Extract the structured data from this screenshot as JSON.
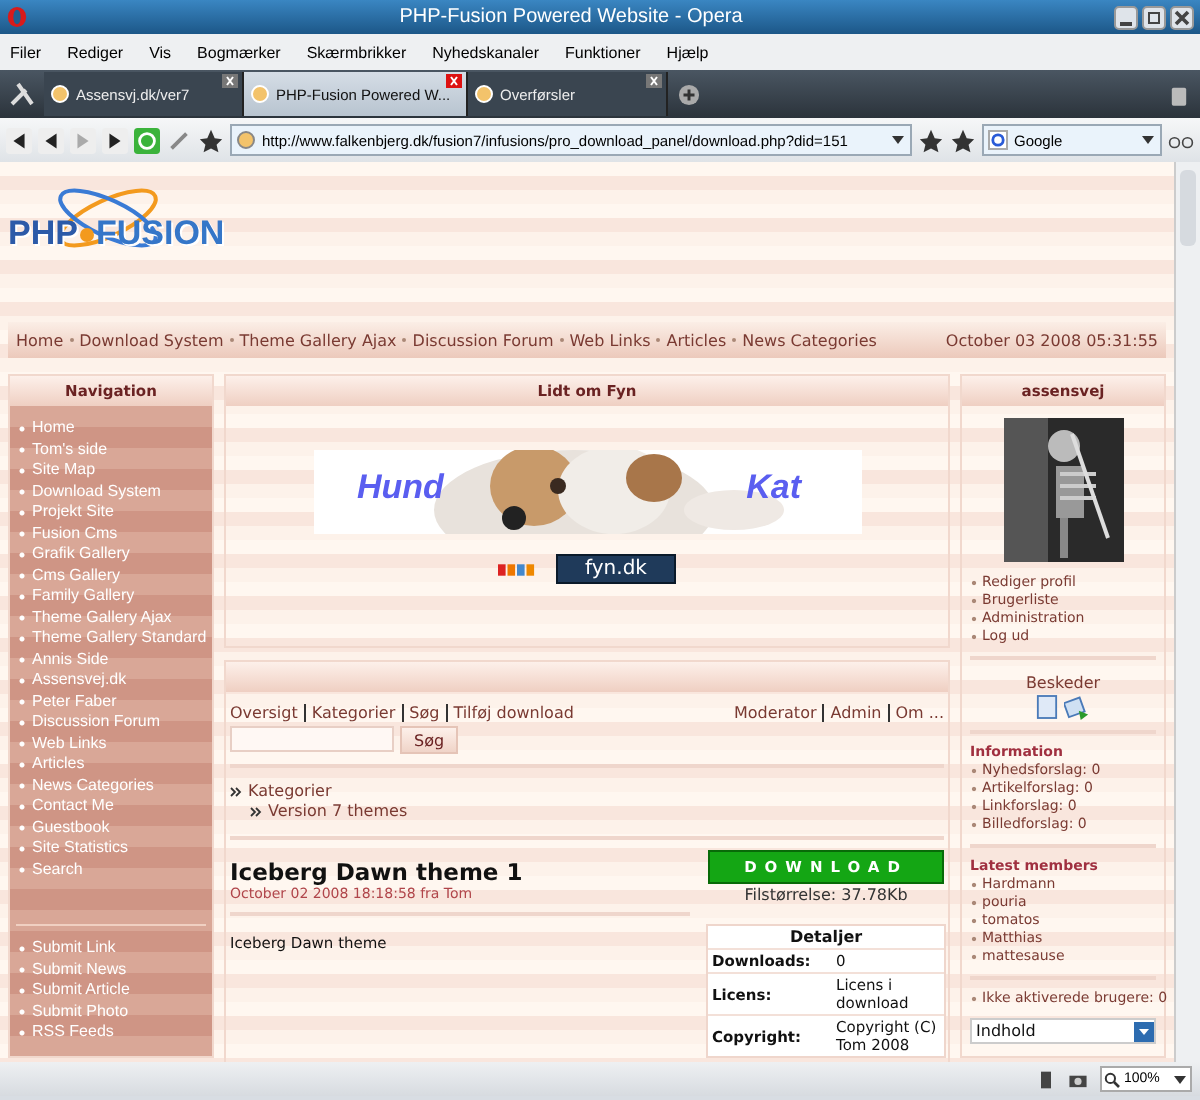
{
  "window": {
    "title": "PHP-Fusion Powered Website - Opera"
  },
  "menu": [
    "Filer",
    "Rediger",
    "Vis",
    "Bogmærker",
    "Skærmbrikker",
    "Nyhedskanaler",
    "Funktioner",
    "Hjælp"
  ],
  "tabs": [
    {
      "label": "Assensvj.dk/ver7",
      "selected": false
    },
    {
      "label": "PHP-Fusion Powered W...",
      "selected": true
    },
    {
      "label": "Overførsler",
      "selected": false
    }
  ],
  "address": {
    "url": "http://www.falkenbjerg.dk/fusion7/infusions/pro_download_panel/download.php?did=151",
    "search": "Google"
  },
  "logo": {
    "left": "PHP",
    "right": "FUSION"
  },
  "site_nav": [
    "Home",
    "Download System",
    "Theme Gallery Ajax",
    "Discussion Forum",
    "Web Links",
    "Articles",
    "News Categories"
  ],
  "date": "October 03 2008 05:31:55",
  "navigation": {
    "title": "Navigation",
    "items": [
      "Home",
      "Tom's side",
      "Site Map",
      "Download System",
      "Projekt Site",
      "Fusion Cms",
      "Grafik Gallery",
      "Cms Gallery",
      "Family Gallery",
      "Theme Gallery Ajax",
      "Theme Gallery Standard",
      "Annis Side",
      "Assensvej.dk",
      "Peter Faber",
      "Discussion Forum",
      "Web Links",
      "Articles",
      "News Categories",
      "Contact Me",
      "Guestbook",
      "Site Statistics",
      "Search"
    ],
    "submit_items": [
      "Submit Link",
      "Submit News",
      "Submit Article",
      "Submit Photo",
      "RSS Feeds"
    ]
  },
  "panel": {
    "title": "Lidt om Fyn",
    "banner_left": "Hund",
    "banner_right": "Kat",
    "badge": "fyn.dk"
  },
  "download": {
    "toolbar_left": [
      "Oversigt",
      "Kategorier",
      "Søg",
      "Tilføj download"
    ],
    "toolbar_right": [
      "Moderator",
      "Admin",
      "Om ..."
    ],
    "search_button": "Søg",
    "breadcrumb": [
      "Kategorier",
      "Version 7 themes"
    ],
    "title": "Iceberg Dawn theme 1",
    "meta": "October 02 2008 18:18:58 fra Tom",
    "description": "Iceberg Dawn theme",
    "button": "DOWNLOAD",
    "filesize": "Filstørrelse: 37.78Kb",
    "details_title": "Detaljer",
    "details": [
      {
        "label": "Downloads:",
        "value": "0"
      },
      {
        "label": "Licens:",
        "value": "Licens i download"
      },
      {
        "label": "Copyright:",
        "value": "Copyright (C) Tom 2008"
      }
    ]
  },
  "user": {
    "title": "assensvej",
    "links": [
      "Rediger profil",
      "Brugerliste",
      "Administration",
      "Log ud"
    ],
    "messages": "Beskeder",
    "info_title": "Information",
    "info": [
      "Nyhedsforslag: 0",
      "Artikelforslag: 0",
      "Linkforslag: 0",
      "Billedforslag: 0"
    ],
    "members_title": "Latest members",
    "members": [
      "Hardmann",
      "pouria",
      "tomatos",
      "Matthias",
      "mattesause"
    ],
    "unactivated": "Ikke aktiverede brugere: 0",
    "select": "Indhold"
  },
  "status_bar": {
    "zoom": "100%"
  }
}
